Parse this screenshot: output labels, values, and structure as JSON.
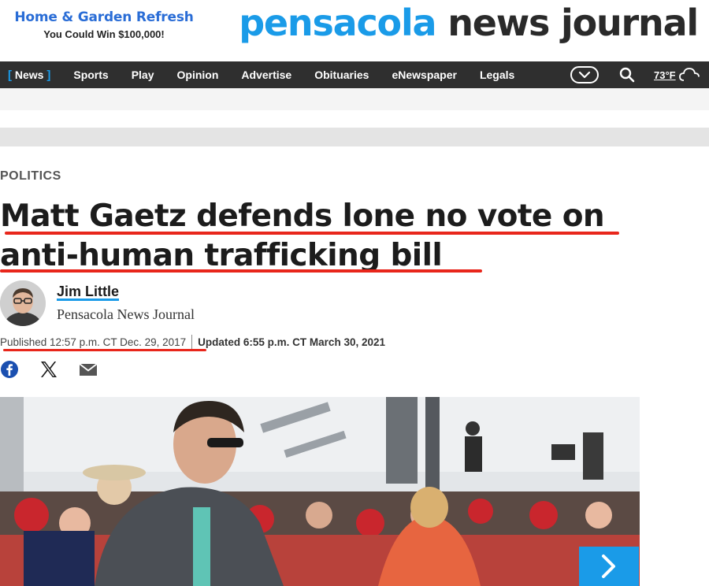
{
  "promo": {
    "title": "Home & Garden Refresh",
    "subtitle": "You Could Win $100,000!"
  },
  "masthead": {
    "part1": "pensacola",
    "part2": " news journal"
  },
  "nav": {
    "items": [
      {
        "label": "News",
        "active": true
      },
      {
        "label": "Sports"
      },
      {
        "label": "Play"
      },
      {
        "label": "Opinion"
      },
      {
        "label": "Advertise"
      },
      {
        "label": "Obituaries"
      },
      {
        "label": "eNewspaper"
      },
      {
        "label": "Legals"
      }
    ],
    "active_bracket_left": "[",
    "active_bracket_right": "]",
    "icons": [
      "chevron-down-icon",
      "search-icon",
      "cloud-icon"
    ],
    "temperature": "73°F"
  },
  "article": {
    "section": "POLITICS",
    "headline": "Matt Gaetz defends lone no vote on anti-human trafficking bill",
    "author_name": "Jim Little",
    "author_org": "Pensacola News Journal",
    "published": "Published 12:57 p.m. CT Dec. 29, 2017",
    "updated": "Updated 6:55 p.m. CT March 30, 2021",
    "share_icons": [
      "facebook-icon",
      "x-icon",
      "email-icon"
    ]
  },
  "colors": {
    "brand_blue": "#1a9be8",
    "nav_bg": "#2f2f2f",
    "annotation_red": "#e8261b"
  }
}
